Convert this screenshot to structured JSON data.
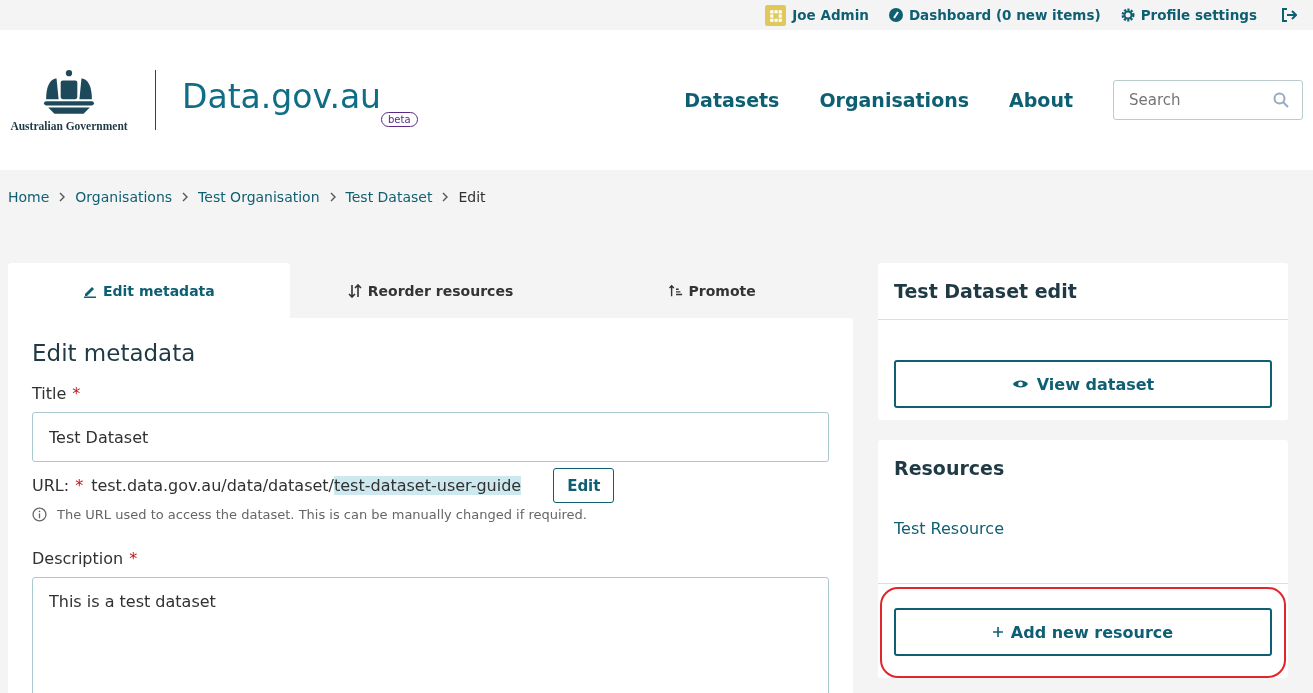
{
  "top_bar": {
    "user": "Joe Admin",
    "dashboard": "Dashboard (0 new items)",
    "profile": "Profile settings"
  },
  "header": {
    "gov_name": "Australian Government",
    "site_name": "Data.gov.au",
    "badge": "beta",
    "nav": [
      {
        "label": "Datasets"
      },
      {
        "label": "Organisations"
      },
      {
        "label": "About"
      }
    ],
    "search": {
      "placeholder": "Search"
    }
  },
  "breadcrumbs": [
    {
      "label": "Home",
      "link": true
    },
    {
      "label": "Organisations",
      "link": true
    },
    {
      "label": "Test Organisation",
      "link": true
    },
    {
      "label": "Test Dataset",
      "link": true
    },
    {
      "label": "Edit",
      "link": false
    }
  ],
  "tabs": [
    {
      "label": "Edit metadata",
      "kind": "edit",
      "selected": true
    },
    {
      "label": "Reorder resources",
      "kind": "reorder",
      "selected": false
    },
    {
      "label": "Promote",
      "kind": "promote",
      "selected": false
    }
  ],
  "form": {
    "heading": "Edit metadata",
    "title_label": "Title",
    "title_mark": "*",
    "title_value": "Test Dataset",
    "url_label": "URL:",
    "url_mark": "*",
    "url_base": "test.data.gov.au/data/dataset/",
    "url_slug": "test-dataset-user-guide",
    "url_slug_selected": true,
    "url_edit": "Edit",
    "url_help": "The URL used to access the dataset. This is can be manually changed if required.",
    "description_label": "Description",
    "description_mark": "*",
    "description_value": "This is a test dataset"
  },
  "sidebar": {
    "title": "Test Dataset edit",
    "view_button": "View dataset",
    "resources_heading": "Resources",
    "resources": [
      {
        "label": "Test Resource"
      }
    ],
    "add_button": "Add new resource",
    "add_button_highlighted": true
  }
}
